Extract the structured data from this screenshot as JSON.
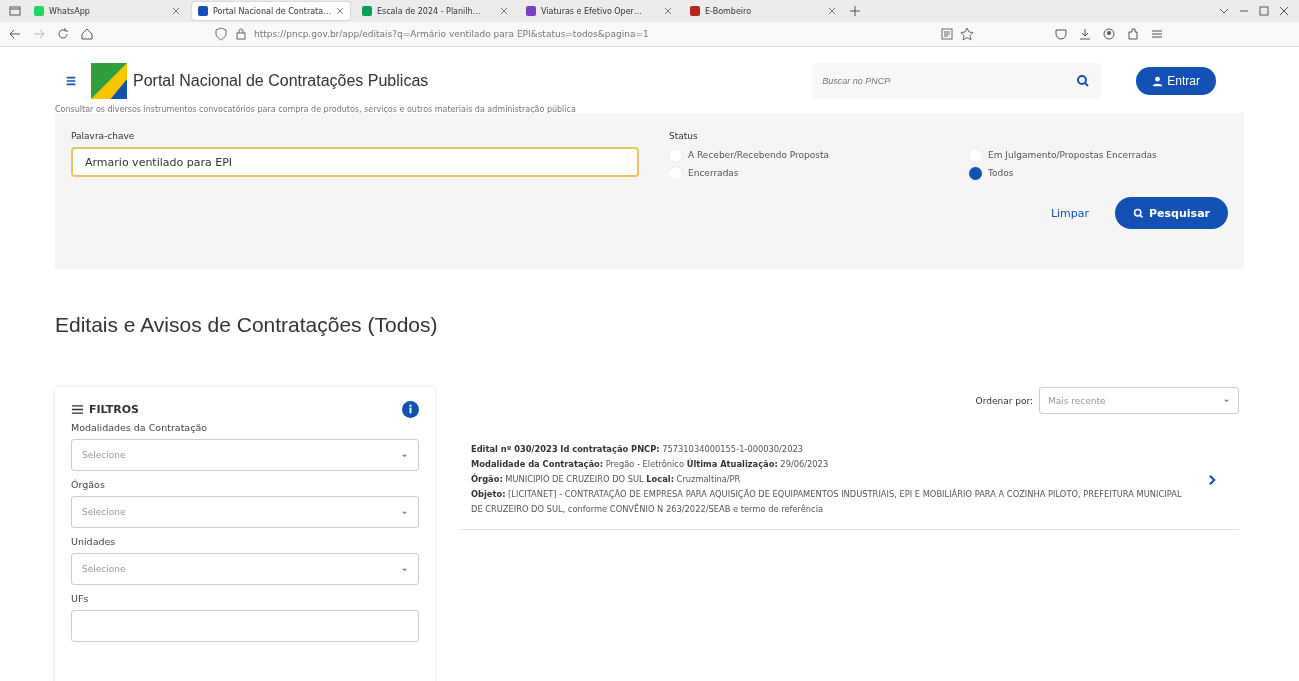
{
  "browser": {
    "tabs": [
      {
        "label": "WhatsApp",
        "selected": false,
        "color": "#25d366"
      },
      {
        "label": "Portal Nacional de Contrata…",
        "selected": true,
        "color": "#1351b4"
      },
      {
        "label": "Escala de 2024 - Planilh…",
        "selected": false,
        "color": "#0f9d58"
      },
      {
        "label": "Viaturas e Efetivo Oper…",
        "selected": false,
        "color": "#7b3fc4"
      },
      {
        "label": "E-Bombeiro",
        "selected": false,
        "color": "#b3261e"
      }
    ],
    "url": "https://pncp.gov.br/app/editais?q=Armário ventilado para EPI&status=todos&pagina=1"
  },
  "header": {
    "title": "Portal Nacional de Contratações Publicas",
    "search_placeholder": "Buscar no PNCP",
    "login": "Entrar"
  },
  "intro": "Consultar os diversos instrumentos convocatórios para compra de produtos, serviços e outros materiais da administração pública",
  "search": {
    "keyword_label": "Palavra-chave",
    "keyword_value": "Armario ventilado para EPI",
    "status_label": "Status",
    "statuses": [
      {
        "label": "A Receber/Recebendo Proposta",
        "selected": false
      },
      {
        "label": "Em Julgamento/Propostas Encerradas",
        "selected": false
      },
      {
        "label": "Encerradas",
        "selected": false
      },
      {
        "label": "Todos",
        "selected": true
      }
    ],
    "clear": "Limpar",
    "submit": "Pesquisar"
  },
  "heading": "Editais e Avisos de Contratações (Todos)",
  "filters": {
    "title": "FILTROS",
    "groups": [
      {
        "label": "Modalidades da Contratação",
        "placeholder": "Selecione"
      },
      {
        "label": "Órgãos",
        "placeholder": "Selecione"
      },
      {
        "label": "Unidades",
        "placeholder": "Selecione"
      },
      {
        "label": "UFs"
      }
    ]
  },
  "sort": {
    "label": "Ordenar por:",
    "value": "Mais recente"
  },
  "results": [
    {
      "lines": [
        "**Edital nº 030/2023**   **Id contratação PNCP:** 75731034000155-1-000030/2023",
        "**Modalidade da Contratação:** Pregão - Eletrônico   **Última Atualização:** 29/06/2023",
        "**Órgão:** MUNICIPIO DE CRUZEIRO DO SUL   **Local:** Cruzmaltina/PR",
        "**Objeto:** [LICITANET] - CONTRATAÇÃO DE EMPRESA PARA AQUISIÇÃO DE EQUIPAMENTOS INDUSTRIAIS, EPI E MOBILIÁRIO PARA A COZINHA PILOTO, PREFEITURA MUNICIPAL DE CRUZEIRO DO SUL, conforme CONVÊNIO N 263/2022/SEAB e termo de referência"
      ]
    }
  ]
}
